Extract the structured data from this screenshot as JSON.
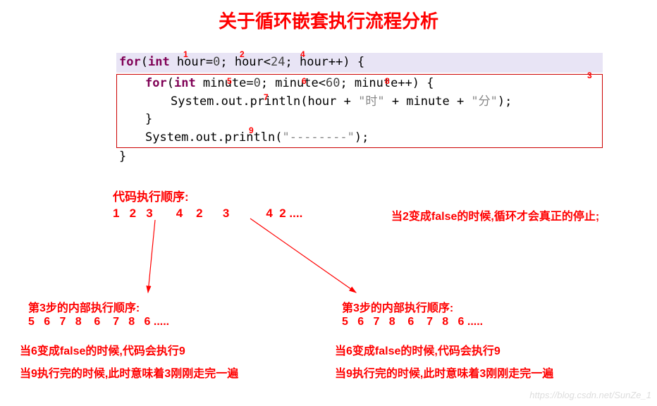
{
  "title": "关于循环嵌套执行流程分析",
  "code": {
    "line1_pre": "for",
    "line1_mid": "(",
    "line1_int": "int",
    "line1_rest": " hour=",
    "line1_zero": "0",
    "line1_c1": "; hour<",
    "line1_n24": "24",
    "line1_c2": "; hour++) {",
    "line2_pre": "for",
    "line2_mid": "(",
    "line2_int": "int",
    "line2_r1": " minute=",
    "line2_zero": "0",
    "line2_c1": "; minute<",
    "line2_n60": "60",
    "line2_c2": "; minute++) {",
    "line3": "System.out.println(hour + ",
    "line3_s1": "\"时\"",
    "line3_m": " + minute + ",
    "line3_s2": "\"分\"",
    "line3_end": ");",
    "line4": "}",
    "line5": "System.out.println(",
    "line5_s": "\"--------\"",
    "line5_end": ");",
    "line6": "}"
  },
  "markers": {
    "m1": "1",
    "m2": "2",
    "m3": "3",
    "m4": "4",
    "m5": "5",
    "m6": "6",
    "m7": "7",
    "m8": "8",
    "m9": "9"
  },
  "analysis": {
    "exec_label": "代码执行顺序:",
    "exec_seq": "1   2   3       4    2      3           4  2 ....",
    "cond2": "当2变成false的时候,循环才会真正的停止;",
    "step3_label": "第3步的内部执行顺序:",
    "step3_seq": "5   6   7   8    6    7   8   6 .....",
    "cond6": "当6变成false的时候,代码会执行9",
    "cond9": "当9执行完的时候,此时意味着3刚刚走完一遍"
  },
  "watermark": "https://blog.csdn.net/SunZe_1"
}
